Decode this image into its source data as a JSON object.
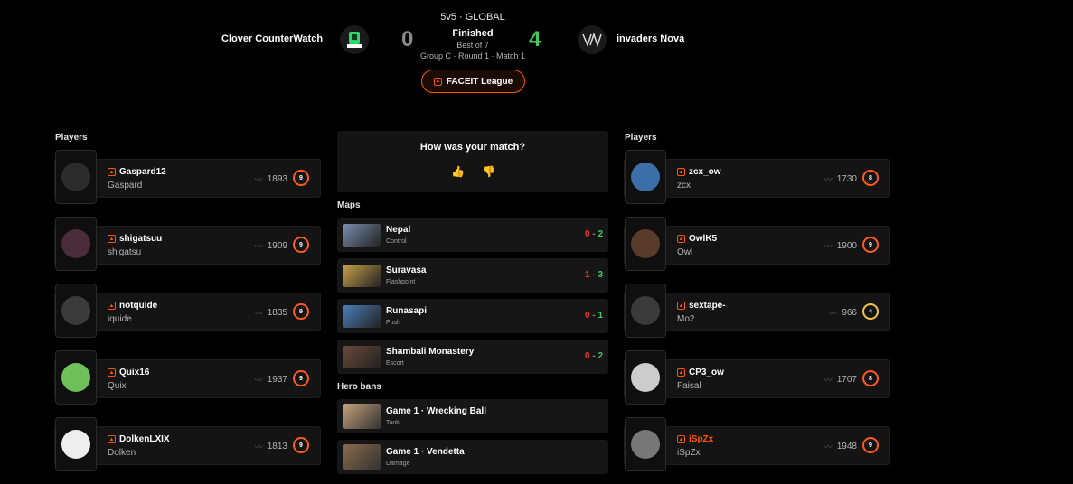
{
  "match": {
    "mode": "5v5 · GLOBAL",
    "status": "Finished",
    "best_of": "Best of 7",
    "round": "Group C · Round 1 · Match 1",
    "league": "FACEIT League",
    "team_left": "Clover CounterWatch",
    "team_right": "invaders Nova",
    "score_left": "0",
    "score_right": "4"
  },
  "players_title": "Players",
  "left_players": [
    {
      "name": "Gaspard12",
      "sub": "Gaspard",
      "elo": "1893",
      "level": "9"
    },
    {
      "name": "shigatsuu",
      "sub": "shigatsu",
      "elo": "1909",
      "level": "9"
    },
    {
      "name": "notquide",
      "sub": "iquide",
      "elo": "1835",
      "level": "9"
    },
    {
      "name": "Quix16",
      "sub": "Quix",
      "elo": "1937",
      "level": "9"
    },
    {
      "name": "DolkenLXIX",
      "sub": "Dolken",
      "elo": "1813",
      "level": "9"
    }
  ],
  "right_players": [
    {
      "name": "zcx_ow",
      "sub": "zcx",
      "elo": "1730",
      "level": "8"
    },
    {
      "name": "OwlK5",
      "sub": "Owl",
      "elo": "1900",
      "level": "9"
    },
    {
      "name": "sextape-",
      "sub": "Mo2",
      "elo": "966",
      "level": "4"
    },
    {
      "name": "CP3_ow",
      "sub": "Faisal",
      "elo": "1707",
      "level": "8"
    },
    {
      "name": "iSpZx",
      "sub": "iSpZx",
      "elo": "1948",
      "level": "9"
    }
  ],
  "feedback": {
    "question": "How was your match?"
  },
  "maps_title": "Maps",
  "maps": [
    {
      "name": "Nepal",
      "type": "Control",
      "left": "0",
      "right": "2"
    },
    {
      "name": "Suravasa",
      "type": "Flashpoint",
      "left": "1",
      "right": "3"
    },
    {
      "name": "Runasapi",
      "type": "Push",
      "left": "0",
      "right": "1"
    },
    {
      "name": "Shambali Monastery",
      "type": "Escort",
      "left": "0",
      "right": "2"
    }
  ],
  "hero_bans_title": "Hero bans",
  "hero_bans": [
    {
      "name": "Game 1 · Wrecking Ball",
      "role": "Tank"
    },
    {
      "name": "Game 1 · Vendetta",
      "role": "Damage"
    }
  ],
  "colors": {
    "accent": "#ff5500",
    "win": "#3fcb5b",
    "lose": "#e53b3b"
  }
}
